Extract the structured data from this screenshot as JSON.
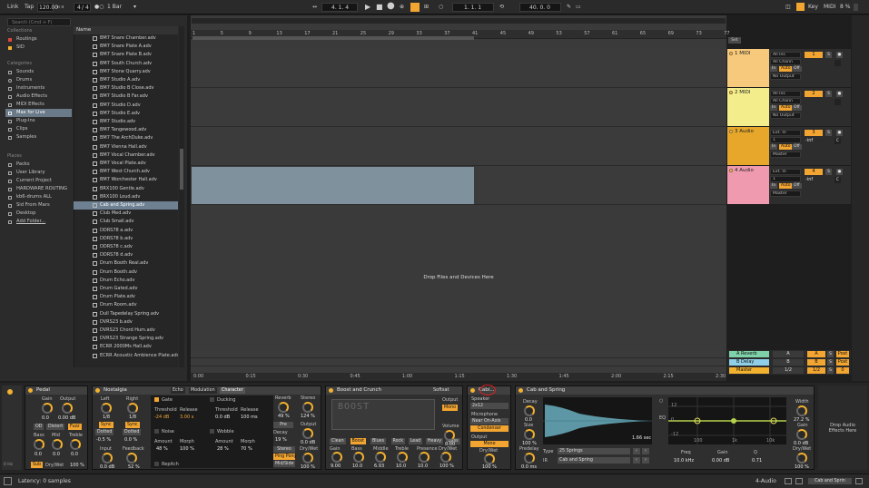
{
  "transport": {
    "link": "Link",
    "tap": "Tap",
    "tempo": "120.00",
    "meter_num": "4",
    "meter_den": "4",
    "quantize": "1 Bar",
    "position": "4.  1.  4",
    "loop_start": "1.  1.  1",
    "loop_length": "40.  0.  0",
    "key": "Key",
    "midi": "MIDI",
    "cpu": "8 %",
    "overdub_icon": "overdub-icon",
    "play_icon": "play-icon",
    "stop_icon": "stop-icon",
    "record_icon": "record-icon"
  },
  "browser": {
    "search_placeholder": "Search (Cmd + F)",
    "collections_title": "Collections",
    "collections": [
      {
        "label": "Routings",
        "color": "#e0463b"
      },
      {
        "label": "SID",
        "color": "#f2b12f"
      }
    ],
    "categories_title": "Categories",
    "categories": [
      "Sounds",
      "Drums",
      "Instruments",
      "Audio Effects",
      "MIDI Effects",
      "Max for Live",
      "Plug-Ins",
      "Clips",
      "Samples"
    ],
    "categories_selected": "Max for Live",
    "places_title": "Places",
    "places": [
      "Packs",
      "User Library",
      "Current Project",
      "HARDWARE ROUTING",
      "kb6-drums ALL",
      "Sid From Mars",
      "Desktop",
      "Add Folder..."
    ],
    "name_header": "Name",
    "files": [
      "BM7 Snare Chamber.adv",
      "BM7 Snare Plate A.adv",
      "BM7 Snare Plate B.adv",
      "BM7 South Church.adv",
      "BM7 Stone Quarry.adv",
      "BM7 Studio A.adv",
      "BM7 Studio B Close.adv",
      "BM7 Studio B Far.adv",
      "BM7 Studio D.adv",
      "BM7 Studio E.adv",
      "BM7 Studio.adv",
      "BM7 Tangewood.adv",
      "BM7 The ArchDuke.adv",
      "BM7 Vienna Hall.adv",
      "BM7 Vocal Chamber.adv",
      "BM7 Vocal Plate.adv",
      "BM7 West Church.adv",
      "BM7 Worchester Hall.adv",
      "BRX100 Gentle.adv",
      "BRX100 Loud.adv",
      "Cab and Spring.adv",
      "Club Med.adv",
      "Club Small.adv",
      "DDRS78 a.adv",
      "DDRS78 b.adv",
      "DDRS78 c.adv",
      "DDRS78 d.adv",
      "Drum Booth Real.adv",
      "Drum Booth.adv",
      "Drum Echo.adv",
      "Drum Gated.adv",
      "Drum Plate.adv",
      "Drum Room.adv",
      "Dull Tapedelay Spring.adv",
      "DVRS23 b.adv",
      "DVRS23 Chord Hum.adv",
      "DVRS23 Strange Spring.adv",
      "ECRR 2000Ms Hall.adv",
      "ECRR Acoustic Ambience Plate.adv"
    ],
    "files_selected": "Cab and Spring.adv"
  },
  "arrangement": {
    "ruler": [
      "1",
      "5",
      "9",
      "13",
      "17",
      "21",
      "25",
      "29",
      "33",
      "37",
      "41",
      "45",
      "49",
      "53",
      "57",
      "61",
      "65",
      "69",
      "73",
      "77"
    ],
    "time_ruler": [
      "0:00",
      "0:15",
      "0:30",
      "0:45",
      "1:00",
      "1:15",
      "1:30",
      "1:45",
      "2:00",
      "2:15",
      "2:30"
    ],
    "drop_hint": "Drop Files and Devices Here",
    "set_label": "Set"
  },
  "tracks": [
    {
      "name": "1 MIDI",
      "color": "#f7c97c",
      "input": "All Ins",
      "channel": "All Chann",
      "monitor": [
        "In",
        "Auto",
        "Off"
      ],
      "output": "No Output",
      "num": "1",
      "vol": "",
      "pan": ""
    },
    {
      "name": "2 MIDI",
      "color": "#f3ee8b",
      "input": "All Ins",
      "channel": "All Chann",
      "monitor": [
        "In",
        "Auto",
        "Off"
      ],
      "output": "No Output",
      "num": "2",
      "vol": "",
      "pan": ""
    },
    {
      "name": "3 Audio",
      "color": "#e6a72a",
      "input": "Ext. In",
      "channel": "1",
      "monitor": [
        "In",
        "Auto",
        "Off"
      ],
      "output": "Master",
      "num": "3",
      "vol": "-inf",
      "pan": "C"
    },
    {
      "name": "4 Audio",
      "color": "#f09ab0",
      "input": "Ext. In",
      "channel": "1",
      "monitor": [
        "In",
        "Auto",
        "Off"
      ],
      "output": "Master",
      "num": "4",
      "vol": "-inf",
      "pan": "C"
    }
  ],
  "returns": [
    {
      "name": "A Reverb",
      "color": "#7fd1a9",
      "num": "A",
      "post": "Post"
    },
    {
      "name": "B Delay",
      "color": "#8fd0e8",
      "num": "B",
      "post": "Post"
    },
    {
      "name": "Master",
      "color": "#f2b12f",
      "num": "1/2",
      "post": "0"
    }
  ],
  "devices": {
    "pedal": {
      "title": "Pedal",
      "gain": "Gain",
      "output": "Output",
      "gain_val": "0.0",
      "output_val": "0.00 dB",
      "types": [
        "OD",
        "Distort",
        "Fuzz"
      ],
      "type_sel": "Fuzz",
      "eq": [
        "Bass",
        "Mid",
        "Treble"
      ],
      "eq_vals": [
        "0.0",
        "0.0",
        "0.0"
      ],
      "sub": "Sub",
      "drywet": "Dry/Wet",
      "drywet_val": "100 %"
    },
    "nostalgia": {
      "title": "Nostalgia",
      "tabs": [
        "Echo",
        "Modulation",
        "Character"
      ],
      "left": "Left",
      "right": "Right",
      "left_val": "1/8",
      "right_val": "1/8",
      "sync": "Sync",
      "dotted": "Dotted",
      "input": "Input",
      "input_val": "0.0 dB",
      "feedback": "Feedback",
      "feedback_val": "52 %",
      "offset_l": "-0.5 %",
      "offset_r": "0.0 %",
      "gate": "Gate",
      "ducking": "Ducking",
      "threshold": "Threshold",
      "release": "Release",
      "gate_thr": "-24 dB",
      "gate_rel": "3.00 s",
      "duck_thr": "0.0 dB",
      "duck_rel": "100 ms",
      "noise": "Noise",
      "wobble": "Wobble",
      "amount": "Amount",
      "morph": "Morph",
      "noise_amt": "48 %",
      "noise_morph": "100 %",
      "wob_amt": "28 %",
      "wob_morph": "70 %",
      "repitch": "Repitch",
      "reverb": "Reverb",
      "reverb_val": "49 %",
      "stereo": "Stereo",
      "stereo_val": "124 %",
      "pre": "Pre",
      "decay": "Decay",
      "decay_val": "19 %",
      "output": "Output",
      "output_val": "0.0 dB",
      "stereo_btn": "Stereo",
      "pingpong": "Ping Pong",
      "midside": "Mid/Side",
      "drywet": "Dry/Wet",
      "drywet_val": "100 %"
    },
    "boost": {
      "title": "Boost and Crunch",
      "softsat": "Softsat",
      "logo": "BOOST",
      "modes": [
        "Clean",
        "Boost",
        "Blues",
        "Rock",
        "Lead",
        "Heavy",
        "Bass"
      ],
      "mode_sel": "Boost",
      "output": "Output",
      "mono": "Mono",
      "volume": "Volume",
      "volume_val": "0.00",
      "knobs": [
        "Gain",
        "Bass",
        "Middle",
        "Treble",
        "Presence",
        "Dry/Wet"
      ],
      "knob_vals": [
        "9.00",
        "10.0",
        "6.93",
        "10.0",
        "10.0",
        "100 %"
      ]
    },
    "cabinet": {
      "title": "Cabi...",
      "speaker": "Speaker",
      "speaker_val": "2x12",
      "mic": "Microphone",
      "mic_val": "Near On-Axis",
      "condenser": "Condenser",
      "output": "Output",
      "mono": "Mono",
      "drywet": "Dry/Wet",
      "drywet_val": "100 %"
    },
    "spring": {
      "title": "Cab and Spring",
      "decay": "Decay",
      "decay_val": "0.0",
      "size": "Size",
      "size_val": "100 %",
      "predelay": "Predelay",
      "predelay_val": "0.0 ms",
      "length": "1.66 sec",
      "type": "Type",
      "type_val": "25 Springs",
      "ir": "IR",
      "ir_val": "Cab and Spring",
      "eq": "EQ",
      "freq": "Freq",
      "gain": "Gain",
      "q": "Q",
      "freq_val": "10.0 kHz",
      "gain_val": "0.00 dB",
      "q_val": "0.71",
      "eq_levels": [
        "12",
        "0",
        "-12"
      ],
      "eq_freqs": [
        "100",
        "1k",
        "10k"
      ],
      "width": "Width",
      "width_val": "27.2 %",
      "gain2": "Gain",
      "gain2_val": "0.0 dB",
      "drywet": "Dry/Wet",
      "drywet_val": "100 %"
    },
    "drop_hint": "Drop Audio Effects Here"
  },
  "status": {
    "latency": "Latency: 0 samples",
    "track": "4-Audio",
    "device": "Cab and Sprin"
  }
}
